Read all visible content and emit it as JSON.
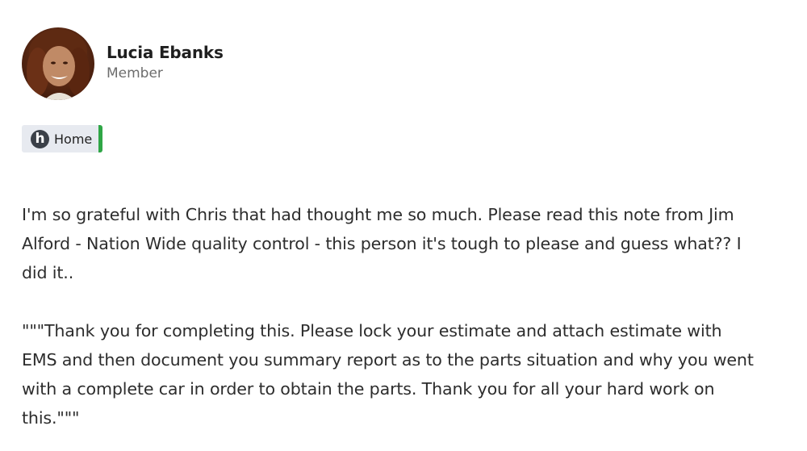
{
  "author": {
    "name": "Lucia Ebanks",
    "role": "Member"
  },
  "tag": {
    "icon": "h-logo-icon",
    "icon_glyph": "h",
    "label": "Home",
    "accent_color": "#2fa646"
  },
  "post": {
    "paragraphs": [
      "I'm so grateful with Chris that had thought me so much. Please read this note from Jim Alford - Nation Wide quality control - this person it's tough to please and guess what?? I did it..",
      "\"\"\"Thank you for completing this. Please lock your estimate and attach estimate with EMS and then document you summary report as to the parts situation and why you went with a complete car in order to obtain the parts. Thank you for all your hard work on this.\"\"\""
    ]
  }
}
